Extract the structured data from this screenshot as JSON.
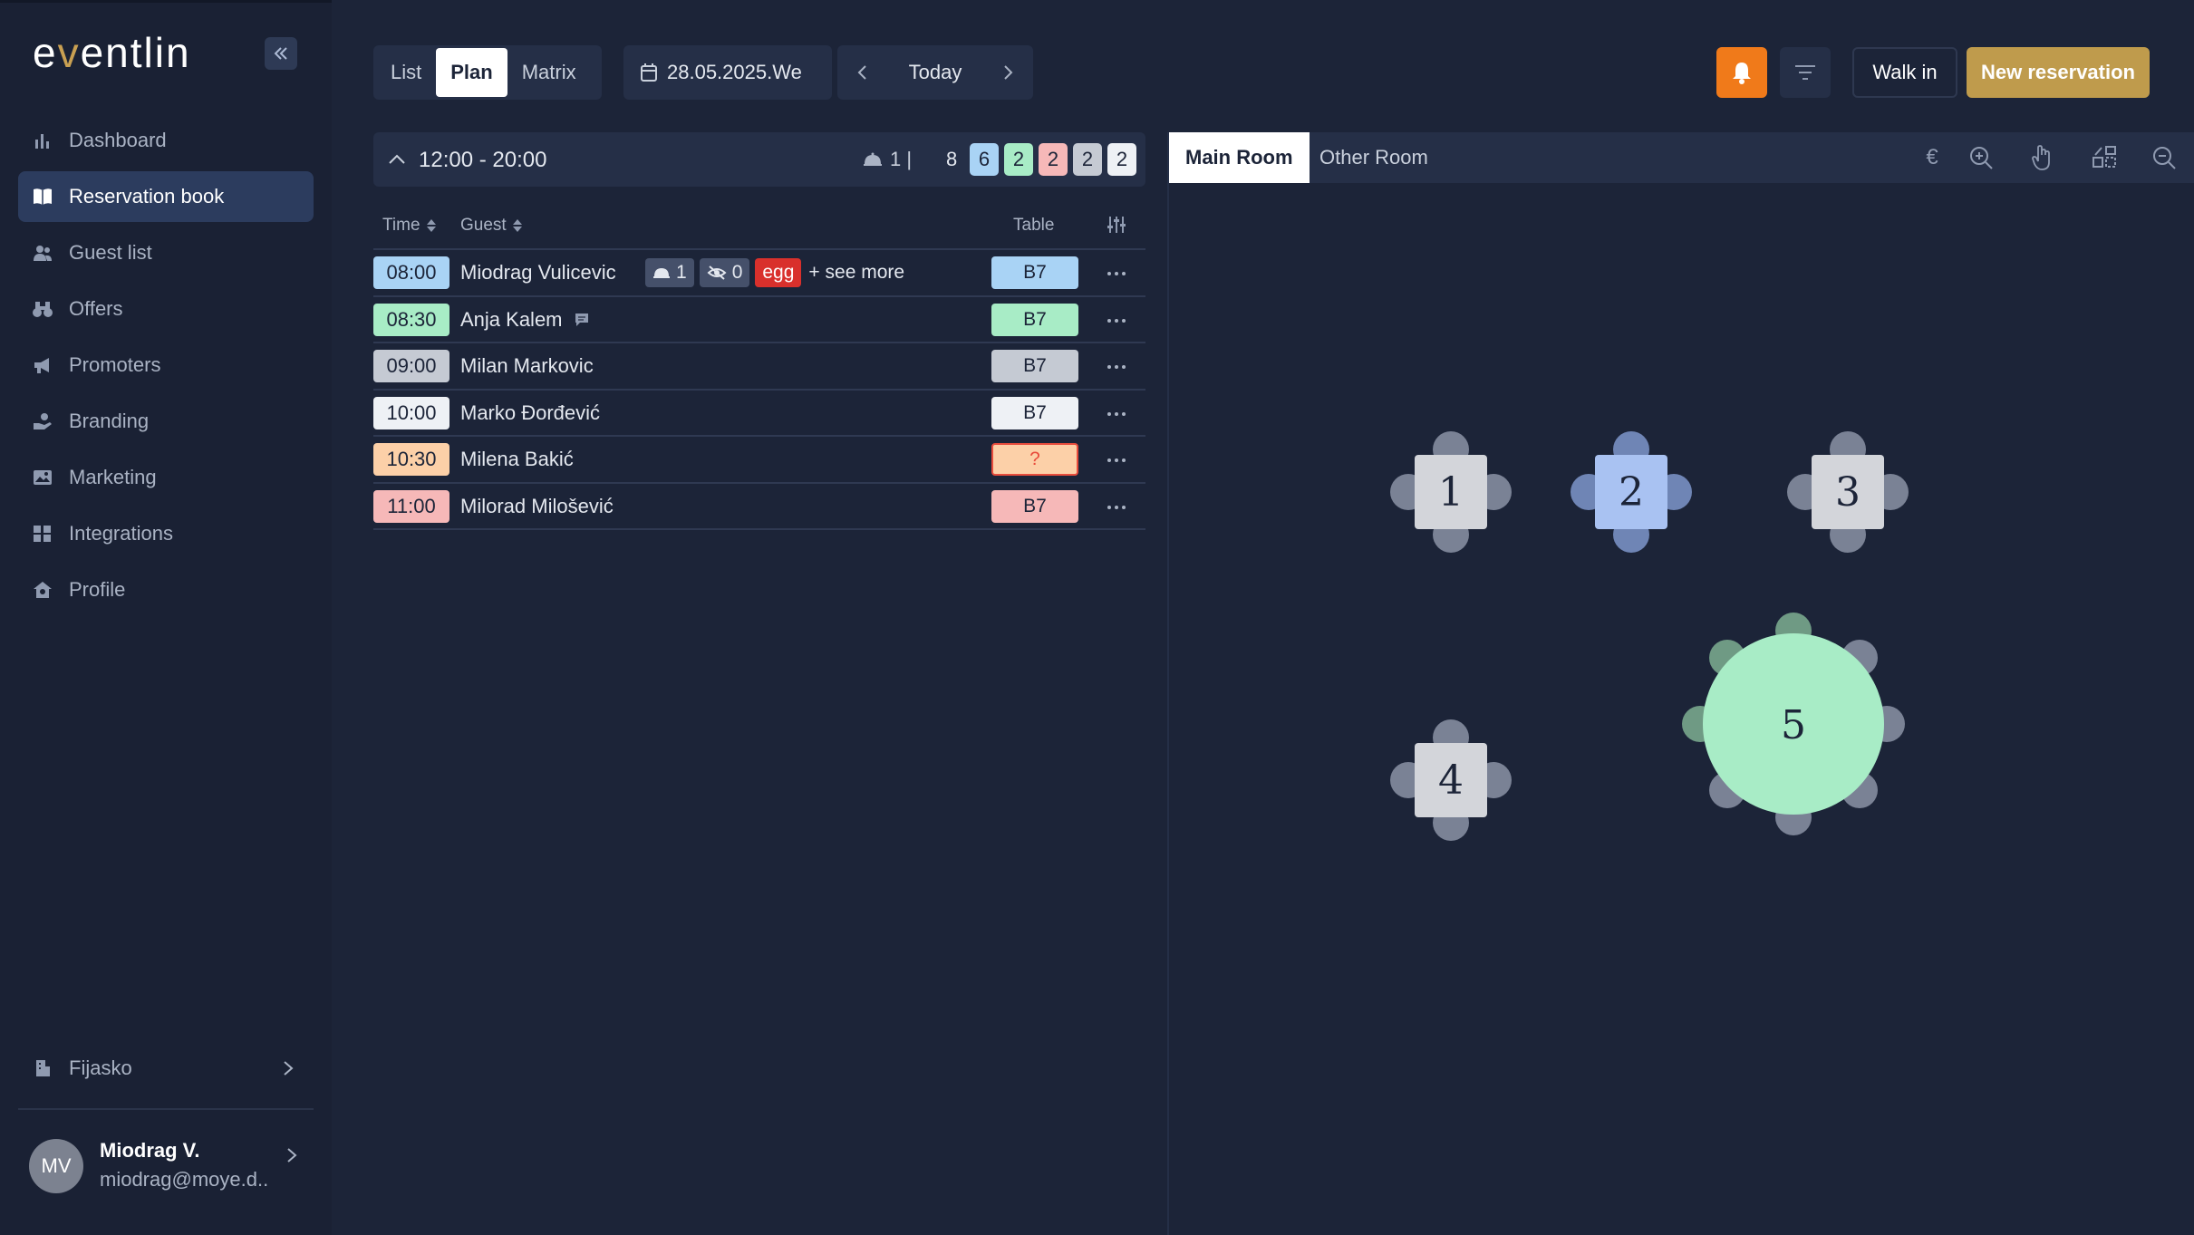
{
  "brand": {
    "name_prefix": "e",
    "name_v": "v",
    "name_suffix": "entlin",
    "accent": "#c9a052"
  },
  "sidebar": {
    "items": [
      {
        "label": "Dashboard",
        "icon": "bar-chart-icon"
      },
      {
        "label": "Reservation book",
        "icon": "book-icon",
        "active": true
      },
      {
        "label": "Guest list",
        "icon": "users-icon"
      },
      {
        "label": "Offers",
        "icon": "binoculars-icon"
      },
      {
        "label": "Promoters",
        "icon": "megaphone-icon"
      },
      {
        "label": "Branding",
        "icon": "hand-coin-icon"
      },
      {
        "label": "Marketing",
        "icon": "image-icon"
      },
      {
        "label": "Integrations",
        "icon": "puzzle-icon"
      },
      {
        "label": "Profile",
        "icon": "home-gear-icon"
      }
    ],
    "venue": "Fijasko",
    "user": {
      "initials": "MV",
      "name": "Miodrag V.",
      "email": "miodrag@moye.d.."
    }
  },
  "toolbar": {
    "view_tabs": [
      "List",
      "Plan",
      "Matrix"
    ],
    "active_view": "Plan",
    "date": "28.05.2025.We",
    "today": "Today",
    "walk_in": "Walk in",
    "new_reservation": "New reservation",
    "bell_color": "#f07a1a",
    "new_res_color": "#bf9b4c"
  },
  "shift": {
    "time_range": "12:00 - 20:00",
    "guests": "1 |",
    "total": "8",
    "badges": [
      {
        "value": "6",
        "color": "#a9d3f5"
      },
      {
        "value": "2",
        "color": "#a8ecc6"
      },
      {
        "value": "2",
        "color": "#f6b8b8"
      },
      {
        "value": "2",
        "color": "#c5cad3"
      },
      {
        "value": "2",
        "color": "#eef1f5"
      }
    ]
  },
  "table_headers": {
    "time": "Time",
    "guest": "Guest",
    "table": "Table"
  },
  "reservations": [
    {
      "time": "08:00",
      "guest": "Miodrag Vulicevic",
      "table": "B7",
      "time_color": "#a9d3f5",
      "table_color": "#a9d3f5",
      "tags": {
        "service": "1",
        "hidden": "0",
        "allergy": "egg",
        "more": "+ see more"
      }
    },
    {
      "time": "08:30",
      "guest": "Anja Kalem",
      "table": "B7",
      "time_color": "#a8ecc6",
      "table_color": "#a8ecc6",
      "note": true
    },
    {
      "time": "09:00",
      "guest": "Milan Markovic",
      "table": "B7",
      "time_color": "#c5cad3",
      "table_color": "#c5cad3"
    },
    {
      "time": "10:00",
      "guest": "Marko Đorđević",
      "table": "B7",
      "time_color": "#eef1f5",
      "table_color": "#eef1f5"
    },
    {
      "time": "10:30",
      "guest": "Milena Bakić",
      "table": "?",
      "time_color": "#fcd0a8",
      "table_color": "#fcd0a8",
      "unassigned": true
    },
    {
      "time": "11:00",
      "guest": "Milorad Milošević",
      "table": "B7",
      "time_color": "#f6b8b8",
      "table_color": "#f6b8b8"
    }
  ],
  "floor": {
    "rooms": [
      "Main Room",
      "Other Room"
    ],
    "active_room": "Main Room",
    "currency": "€",
    "tables": [
      {
        "number": "1",
        "shape": "square",
        "color": "#d3d5da"
      },
      {
        "number": "2",
        "shape": "square",
        "color": "#a9c2f2"
      },
      {
        "number": "3",
        "shape": "square",
        "color": "#d3d5da"
      },
      {
        "number": "4",
        "shape": "square",
        "color": "#d3d5da"
      },
      {
        "number": "5",
        "shape": "round",
        "color": "#a8ecc6"
      }
    ]
  }
}
